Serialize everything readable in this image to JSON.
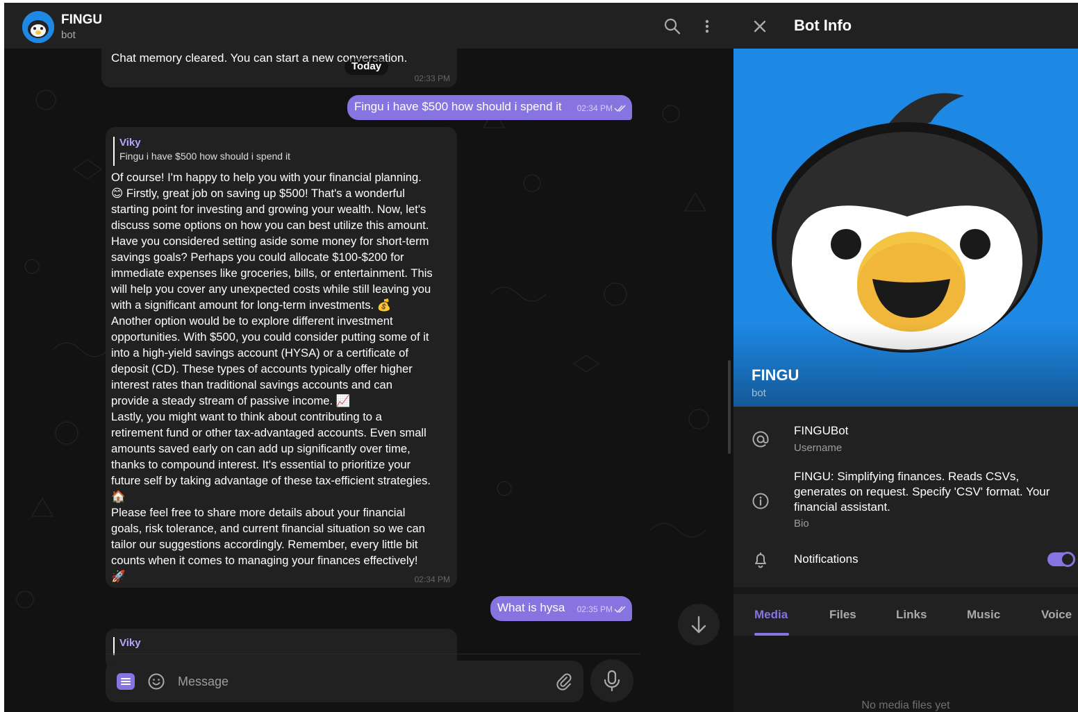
{
  "chat": {
    "title": "FINGU",
    "subtitle": "bot",
    "date_pill": "Today",
    "composer_placeholder": "Message"
  },
  "messages": [
    {
      "text": "Chat memory cleared. You can start a new conversation.",
      "time": "02:33 PM"
    },
    {
      "text": "Fingu i have $500 how should i spend it",
      "time": "02:34 PM"
    },
    {
      "reply_name": "Viky",
      "reply_text": "Fingu i have $500 how should i spend it",
      "lines": [
        "Of course! I'm happy to help you with your financial planning.",
        "😊 Firstly, great job on saving up $500! That's a wonderful",
        "starting point for investing and growing your wealth. Now, let's",
        "discuss some options on how you can best utilize this amount.",
        "Have you considered setting aside some money for short-term",
        "savings goals? Perhaps you could allocate $100-$200 for",
        "immediate expenses like groceries, bills, or entertainment. This",
        "will help you cover any unexpected costs while still leaving you",
        "with a significant amount for long-term investments. 💰",
        "Another option would be to explore different investment",
        "opportunities. With $500, you could consider putting some of it",
        "into a high-yield savings account (HYSA) or a certificate of",
        "deposit (CD). These types of accounts typically offer higher",
        "interest rates than traditional savings accounts and can",
        "provide a steady stream of passive income. 📈",
        "Lastly, you might want to think about contributing to a",
        "retirement fund or other tax-advantaged accounts. Even small",
        "amounts saved early on can add up significantly over time,",
        "thanks to compound interest. It's essential to prioritize your",
        "future self by taking advantage of these tax-efficient strategies.",
        "🏠",
        "Please feel free to share more details about your financial",
        "goals, risk tolerance, and current financial situation so we can",
        "tailor our suggestions accordingly. Remember, every little bit",
        "counts when it comes to managing your finances effectively!",
        "🚀"
      ],
      "time": "02:34 PM"
    },
    {
      "text": "What is hysa",
      "time": "02:35 PM"
    },
    {
      "reply_name": "Viky"
    }
  ],
  "info": {
    "header_title": "Bot Info",
    "name": "FINGU",
    "subtitle": "bot",
    "username": "FINGUBot",
    "username_label": "Username",
    "bio_lines": [
      "FINGU: Simplifying finances. Reads CSVs,",
      "generates on request. Specify 'CSV' format. Your",
      "financial assistant."
    ],
    "bio_label": "Bio",
    "notifications_label": "Notifications",
    "notifications_on": true,
    "tabs": [
      "Media",
      "Files",
      "Links",
      "Music",
      "Voice"
    ],
    "active_tab": "Media",
    "empty_media": "No media files yet"
  },
  "icons": {
    "search": "search-icon",
    "more": "more-vertical-icon",
    "close": "close-icon",
    "username": "at-sign-icon",
    "bio": "info-icon",
    "notifications": "bell-icon",
    "scroll_down": "arrow-down-icon",
    "bot_menu": "bot-menu-icon",
    "emoji": "smiley-icon",
    "attach": "paperclip-icon",
    "voice": "microphone-icon",
    "read_status": "double-check-icon"
  },
  "colors": {
    "accent": "#8774e1",
    "outgoing_bubble": "#8774e1",
    "incoming_bubble": "#212121",
    "hero_background": "#1e88e5",
    "reply_name": "#b7a5ff"
  }
}
